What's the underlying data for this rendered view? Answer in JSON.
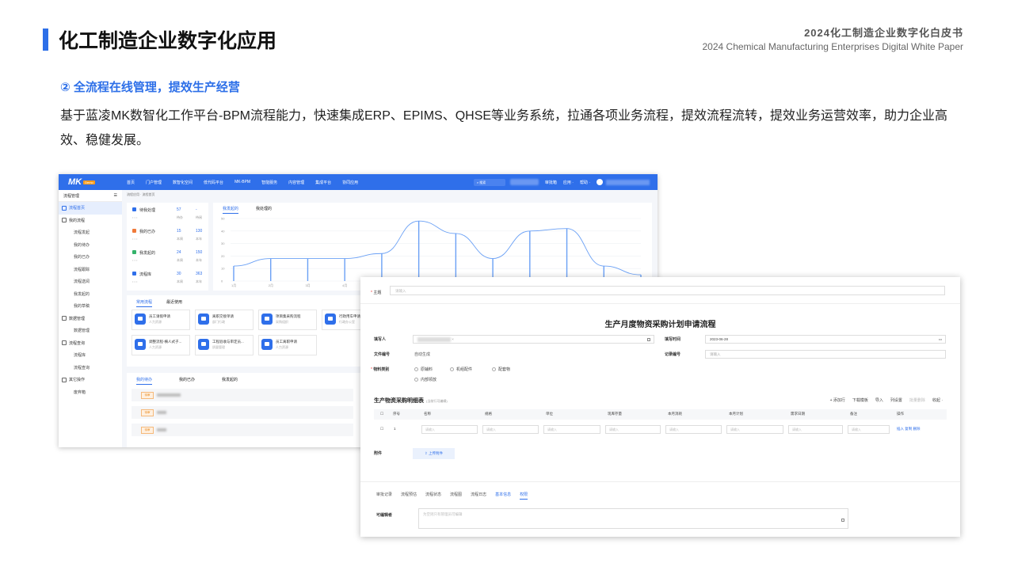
{
  "page": {
    "title": "化工制造企业数字化应用",
    "whitepaper_cn": "2024化工制造企业数字化白皮书",
    "whitepaper_en": "2024 Chemical Manufacturing Enterprises Digital White Paper",
    "section_heading": "② 全流程在线管理，提效生产经营",
    "body": "基于蓝凌MK数智化工作平台-BPM流程能力，快速集成ERP、EPIMS、QHSE等业务系统，拉通各项业务流程，提效流程流转，提效业务运营效率，助力企业高效、稳健发展。",
    "accent_color": "#2d6fe8"
  },
  "app": {
    "logo": "MK",
    "logo_badge": "Demo",
    "nav": [
      "首页",
      "门户管理",
      "数智化空间",
      "低代码平台",
      "MK-BPM",
      "智能服务",
      "内容管理",
      "集成平台",
      "协同应用"
    ],
    "search_placeholder": "搜索",
    "nav_right": [
      "审批箱",
      "应用 ·",
      "帮助 ·"
    ],
    "sidebar_title": "流程管理",
    "sidebar": [
      {
        "label": "流程首页",
        "type": "main",
        "active": true,
        "icon": "home-icon"
      },
      {
        "label": "我的流程",
        "type": "main",
        "icon": "doc-icon"
      },
      {
        "label": "流程发起",
        "type": "sub"
      },
      {
        "label": "我的待办",
        "type": "sub"
      },
      {
        "label": "我的已办",
        "type": "sub"
      },
      {
        "label": "流程跟踪",
        "type": "sub"
      },
      {
        "label": "流程送阅",
        "type": "sub"
      },
      {
        "label": "我发起的",
        "type": "sub"
      },
      {
        "label": "我的草稿",
        "type": "sub"
      },
      {
        "label": "数据管理",
        "type": "main",
        "icon": "db-icon"
      },
      {
        "label": "数据管理",
        "type": "sub"
      },
      {
        "label": "流程查询",
        "type": "main",
        "icon": "search-icon"
      },
      {
        "label": "流程库",
        "type": "sub"
      },
      {
        "label": "流程查询",
        "type": "sub"
      },
      {
        "label": "其它操作",
        "type": "main",
        "icon": "grid-icon"
      },
      {
        "label": "废弃箱",
        "type": "sub"
      }
    ],
    "breadcrumb": "流程应用 · 流程首页",
    "stats": [
      {
        "label": "待我处理",
        "v1": "57",
        "s1": "待办",
        "v2": "-",
        "s2": "待阅",
        "color": "#2f6fea"
      },
      {
        "label": "我的已办",
        "v1": "15",
        "s1": "本周",
        "v2": "130",
        "s2": "本年",
        "color": "#f07a3a"
      },
      {
        "label": "我发起的",
        "v1": "24",
        "s1": "本周",
        "v2": "150",
        "s2": "本年",
        "color": "#34b36b"
      },
      {
        "label": "流程库",
        "v1": "30",
        "s1": "本周",
        "v2": "363",
        "s2": "本年",
        "color": "#2f6fea"
      }
    ],
    "chart_tabs": [
      "我发起的",
      "我处理的"
    ],
    "common_tabs": [
      "常用流程",
      "最近使用"
    ],
    "cards": [
      {
        "title": "员工请假申请",
        "sub": "人力资源"
      },
      {
        "title": "离职交接单请",
        "sub": "部门行政"
      },
      {
        "title": "项目集采购流程",
        "sub": "采购组织"
      },
      {
        "title": "行政用车申请",
        "sub": "行政办公室"
      },
      {
        "title": "调整流程-横人式子...",
        "sub": "人力资源"
      },
      {
        "title": "工程验收与审定员...",
        "sub": "质量管理"
      },
      {
        "title": "员工离职申请",
        "sub": "人力资源"
      }
    ],
    "todo_tabs": [
      "我的待办",
      "我的已办",
      "我发起的"
    ],
    "todo_badge": "待审"
  },
  "chart_data": {
    "type": "line",
    "title": "",
    "x_ticks": [
      "1月",
      "2月",
      "3月",
      "4月"
    ],
    "y_ticks": [
      0,
      10,
      20,
      30,
      40,
      50
    ],
    "ylim": [
      0,
      50
    ],
    "x": [
      1,
      2,
      3,
      4,
      5,
      6,
      7,
      8,
      9,
      10,
      11,
      12
    ],
    "values": [
      12,
      18,
      18,
      18,
      22,
      48,
      38,
      18,
      40,
      42,
      12,
      5
    ]
  },
  "form": {
    "subject_label": "主题",
    "subject_placeholder": "请输入",
    "title": "生产月度物资采购计划申请流程",
    "filler_label": "填写人",
    "fill_time_label": "填写时间",
    "fill_time_value": "2023-06-28",
    "doc_no_label": "文件编号",
    "doc_no_value": "自动生成",
    "record_no_label": "记录编号",
    "record_no_placeholder": "请输入",
    "material_label": "物料类别",
    "material_options": [
      "原辅料",
      "机组配件",
      "配套物",
      "内部领放"
    ],
    "detail_title": "生产物资采购明细表",
    "detail_hint": "(当前行可编辑)",
    "toolbar": [
      "+ 添加行",
      "下载模板",
      "导入",
      "列设置",
      "批量删除",
      "收起 ·"
    ],
    "columns": [
      "序号",
      "名称",
      "规格",
      "单位",
      "现库存量",
      "本月消耗",
      "本月计划",
      "需求日期",
      "备注",
      "操作"
    ],
    "row_index": "1",
    "cell_placeholder": "请输入",
    "row_actions": "插入 复制 删除",
    "attach_label": "附件",
    "attach_button": "上传附件",
    "bottom_tabs": [
      "审批记录",
      "流程预估",
      "流程状态",
      "流程图",
      "流程日志",
      "基本信息",
      "权限"
    ],
    "editor_label": "可编辑者",
    "editor_placeholder": "为空则只有管理员可编辑"
  }
}
